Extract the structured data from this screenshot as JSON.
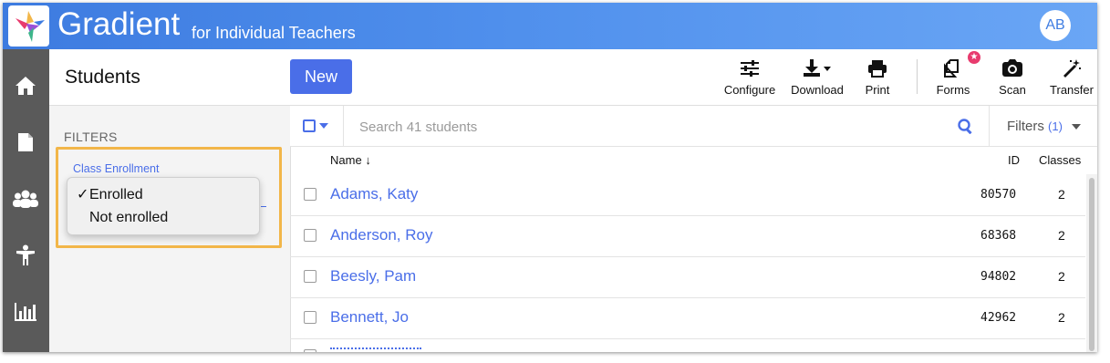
{
  "app": {
    "name": "Gradient",
    "subtitle": "for Individual Teachers",
    "avatar_initials": "AB"
  },
  "colors": {
    "accent": "#4a6ee8",
    "header_start": "#3d7be0",
    "header_end": "#6aa6f5",
    "sidebar": "#5a5a5a",
    "highlight": "#f2b649",
    "badge": "#e83b6e"
  },
  "sidebar": {
    "items": [
      {
        "icon": "home-icon"
      },
      {
        "icon": "document-icon"
      },
      {
        "icon": "group-icon"
      },
      {
        "icon": "student-icon"
      },
      {
        "icon": "bar-chart-icon"
      }
    ]
  },
  "page": {
    "title": "Students",
    "new_label": "New"
  },
  "toolbar": {
    "configure": "Configure",
    "download": "Download",
    "print": "Print",
    "forms": "Forms",
    "forms_badge": "★",
    "scan": "Scan",
    "transfer": "Transfer"
  },
  "filters": {
    "heading": "FILTERS",
    "field_label": "Class Enrollment",
    "options": [
      {
        "label": "Enrolled",
        "checked": true
      },
      {
        "label": "Not enrolled",
        "checked": false
      }
    ]
  },
  "list": {
    "search_placeholder": "Search 41 students",
    "filters_label": "Filters",
    "filters_count": "(1)",
    "columns": {
      "name": "Name",
      "sort_indicator": "↓",
      "id": "ID",
      "classes": "Classes"
    },
    "rows": [
      {
        "name": "Adams, Katy",
        "id": "80570",
        "classes": "2"
      },
      {
        "name": "Anderson, Roy",
        "id": "68368",
        "classes": "2"
      },
      {
        "name": "Beesly, Pam",
        "id": "94802",
        "classes": "2"
      },
      {
        "name": "Bennett, Jo",
        "id": "42962",
        "classes": "2"
      }
    ]
  }
}
